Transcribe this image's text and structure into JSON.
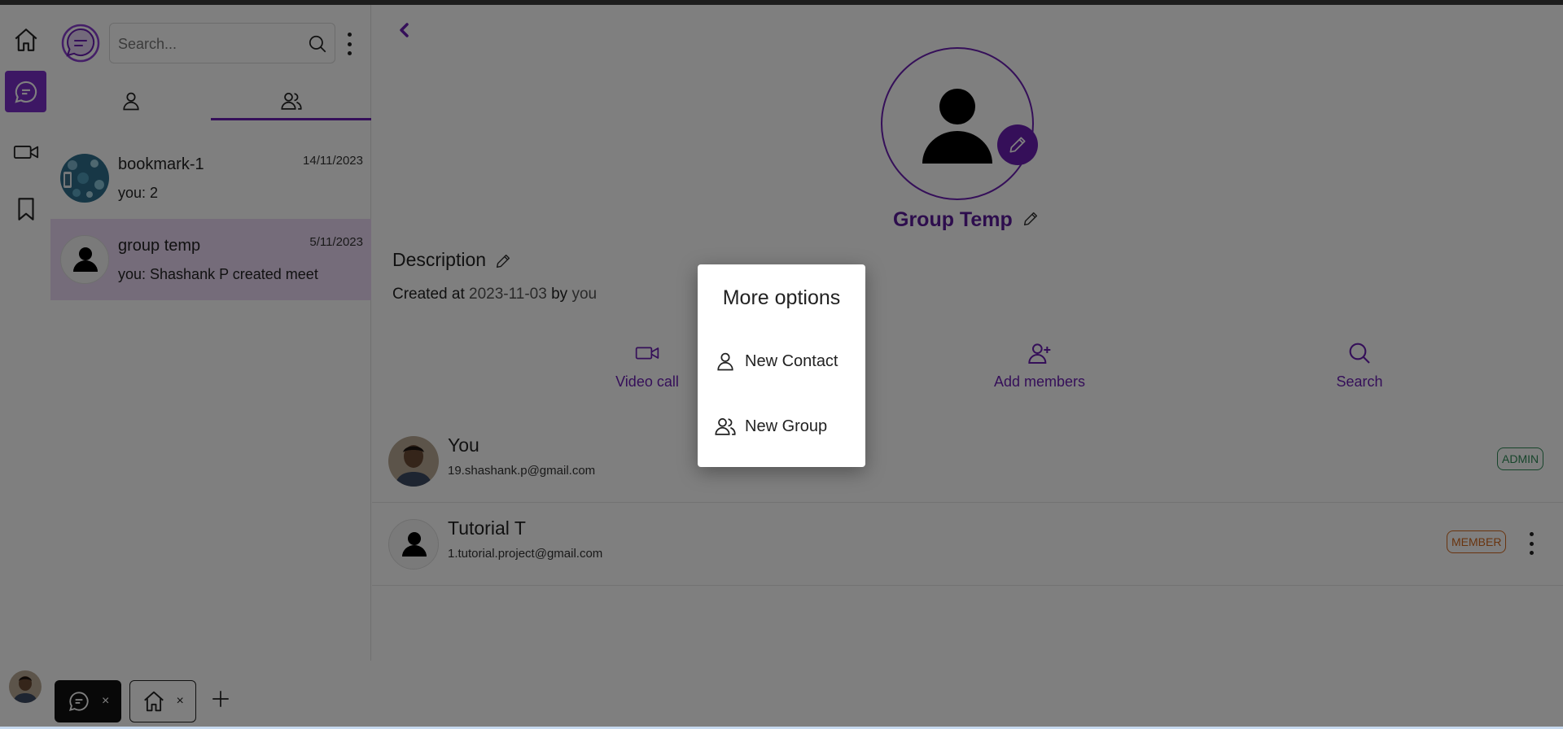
{
  "colors": {
    "accent": "#6a1fb3",
    "rail_active": "#7b2ec9",
    "selected_chat": "#ead8f5",
    "admin": "#2e8b57",
    "member": "#d2691e"
  },
  "rail": {
    "items": [
      {
        "icon": "home-icon"
      },
      {
        "icon": "chat-icon",
        "active": true
      },
      {
        "icon": "video-icon"
      },
      {
        "icon": "bookmark-icon"
      }
    ]
  },
  "panel": {
    "search_placeholder": "Search...",
    "tabs": [
      {
        "icon": "user-icon"
      },
      {
        "icon": "users-icon",
        "active": true
      }
    ],
    "chats": [
      {
        "name": "bookmark-1",
        "date": "14/11/2023",
        "last": "you: 2"
      },
      {
        "name": "group temp",
        "date": "5/11/2023",
        "last": "you: Shashank P created meet",
        "selected": true
      }
    ]
  },
  "group": {
    "title": "Group Temp",
    "description_label": "Description",
    "created_prefix": "Created at",
    "created_date": "2023-11-03",
    "created_by_word": "by",
    "created_by": "you",
    "actions": [
      {
        "icon": "video-icon",
        "label": "Video call"
      },
      {
        "icon": "add-user-icon",
        "label": "Add members"
      },
      {
        "icon": "search-icon",
        "label": "Search"
      }
    ],
    "members": [
      {
        "name": "You",
        "email": "19.shashank.p@gmail.com",
        "role": "ADMIN"
      },
      {
        "name": "Tutorial T",
        "email": "1.tutorial.project@gmail.com",
        "role": "MEMBER"
      }
    ]
  },
  "bottom_tabs": [
    {
      "icon": "chat-icon",
      "close": "×"
    },
    {
      "icon": "home-icon",
      "close": "×"
    }
  ],
  "dialog": {
    "title": "More options",
    "options": [
      {
        "icon": "user-icon",
        "label": "New Contact"
      },
      {
        "icon": "users-icon",
        "label": "New Group"
      }
    ]
  }
}
